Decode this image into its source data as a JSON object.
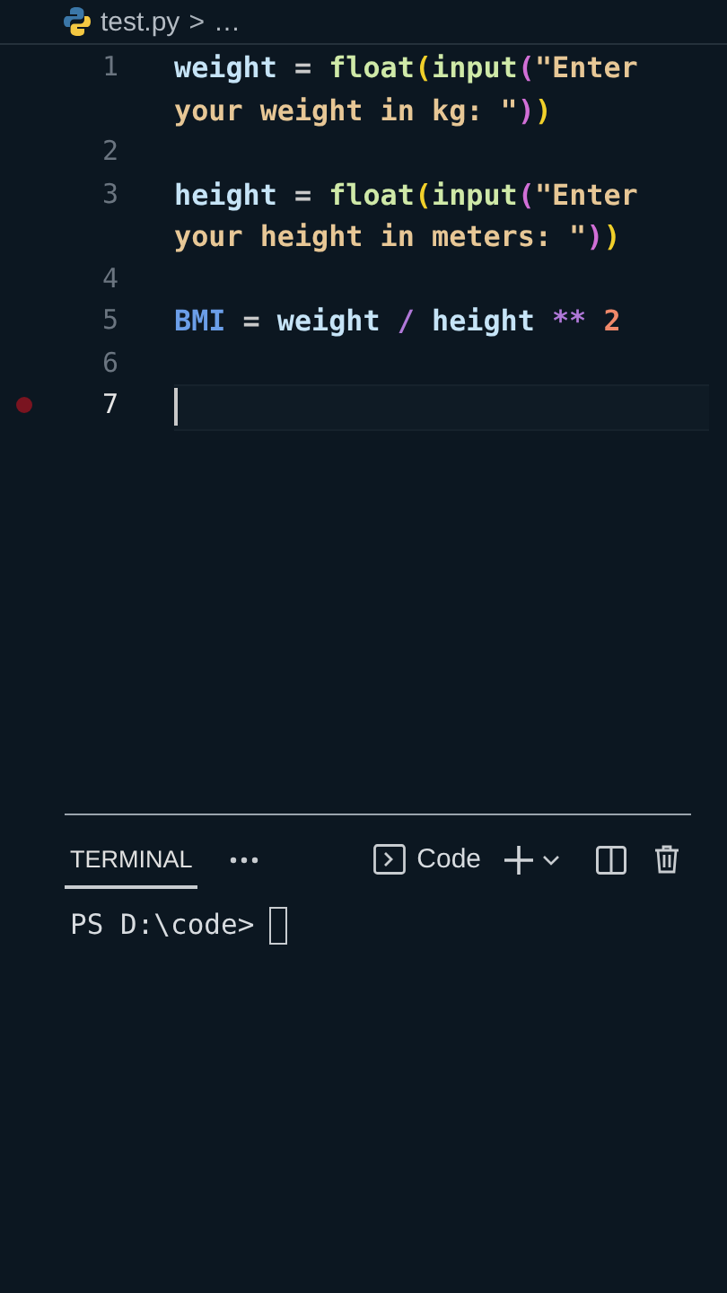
{
  "breadcrumb": {
    "file": "test.py",
    "separator": ">",
    "rest": "…"
  },
  "lines": [
    {
      "number": "1",
      "breakpoint": false,
      "current": false,
      "tokens": [
        {
          "kind": "var",
          "text": "weight"
        },
        {
          "kind": "op",
          "text": " = "
        },
        {
          "kind": "func",
          "text": "float"
        },
        {
          "kind": "bracket1",
          "text": "("
        },
        {
          "kind": "func",
          "text": "input"
        },
        {
          "kind": "bracket2",
          "text": "("
        },
        {
          "kind": "string",
          "text": "\"Enter your weight in kg: \""
        },
        {
          "kind": "bracket2",
          "text": ")"
        },
        {
          "kind": "bracket1",
          "text": ")"
        }
      ]
    },
    {
      "number": "2",
      "breakpoint": false,
      "current": false
    },
    {
      "number": "3",
      "breakpoint": false,
      "current": false,
      "tokens": [
        {
          "kind": "var",
          "text": "height"
        },
        {
          "kind": "op",
          "text": " = "
        },
        {
          "kind": "func",
          "text": "float"
        },
        {
          "kind": "bracket1",
          "text": "("
        },
        {
          "kind": "func",
          "text": "input"
        },
        {
          "kind": "bracket2",
          "text": "("
        },
        {
          "kind": "string",
          "text": "\"Enter your height in meters: \""
        },
        {
          "kind": "bracket2",
          "text": ")"
        },
        {
          "kind": "bracket1",
          "text": ")"
        }
      ]
    },
    {
      "number": "4",
      "breakpoint": false,
      "current": false
    },
    {
      "number": "5",
      "breakpoint": false,
      "current": false,
      "tokens": [
        {
          "kind": "const",
          "text": "BMI"
        },
        {
          "kind": "op",
          "text": " = "
        },
        {
          "kind": "var",
          "text": "weight"
        },
        {
          "kind": "keyop",
          "text": " / "
        },
        {
          "kind": "var",
          "text": "height"
        },
        {
          "kind": "keyop",
          "text": " ** "
        },
        {
          "kind": "number",
          "text": "2"
        }
      ]
    },
    {
      "number": "6",
      "breakpoint": false,
      "current": false
    },
    {
      "number": "7",
      "breakpoint": true,
      "current": true
    }
  ],
  "terminal": {
    "tabs": [
      {
        "label": "TERMINAL",
        "selected": true
      }
    ],
    "profile": "Code",
    "prompt": "PS D:\\code>"
  }
}
